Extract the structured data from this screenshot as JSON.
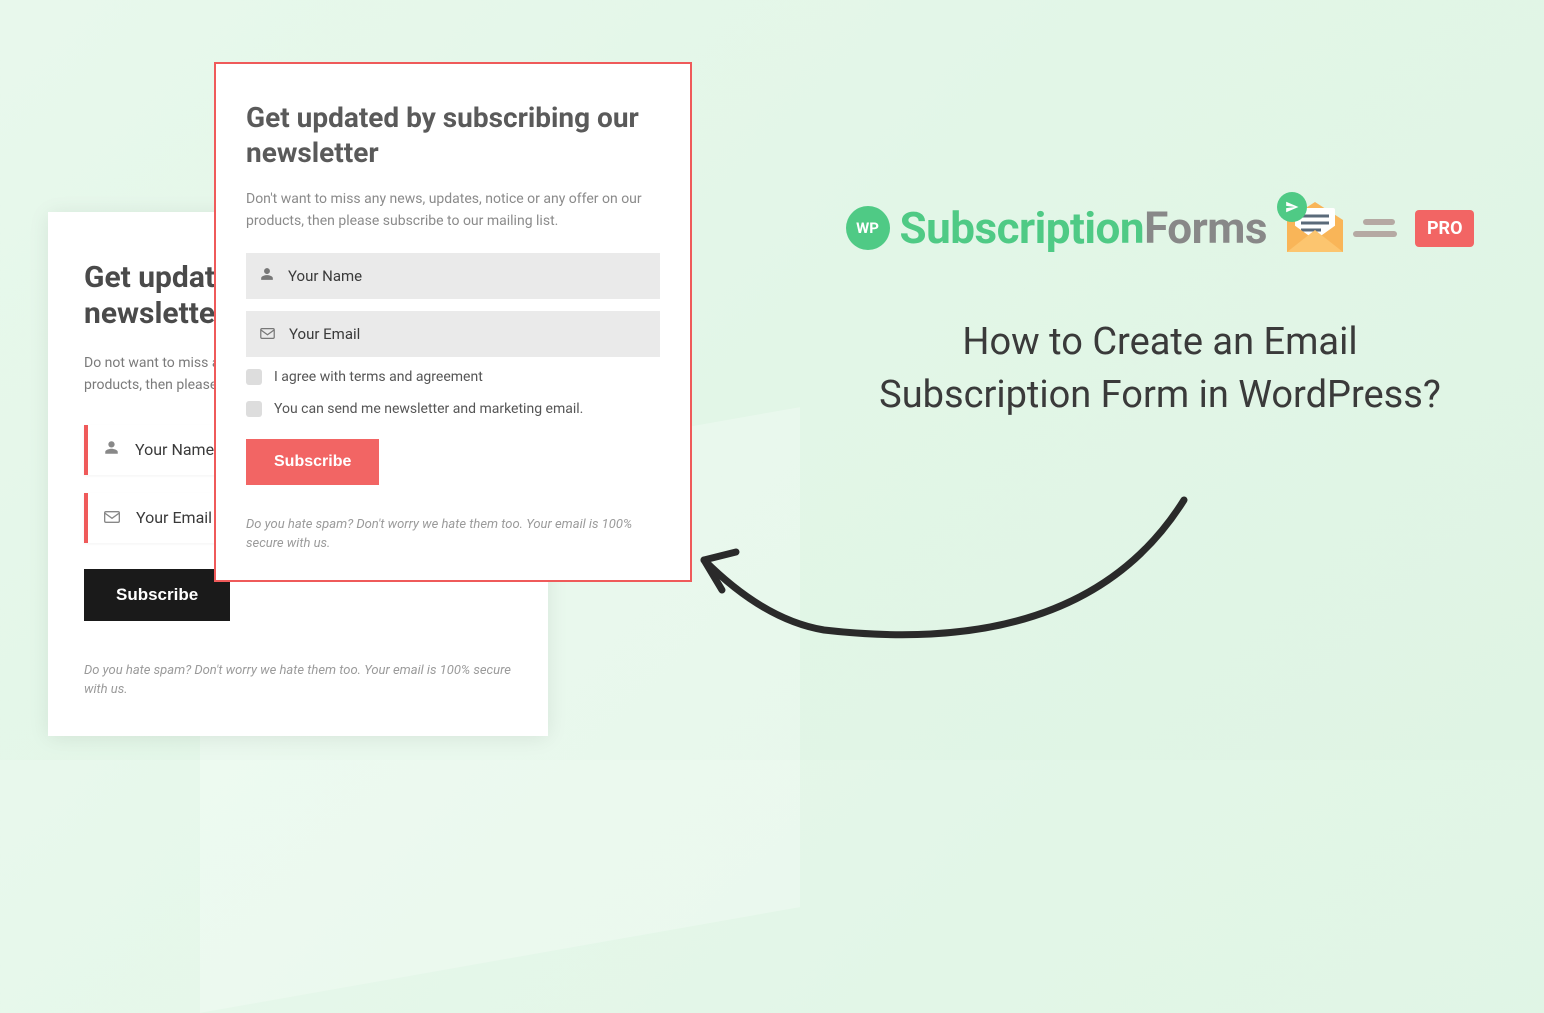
{
  "brand": {
    "wp_badge": "WP",
    "word_subscription": "Subscription",
    "word_forms": "Forms",
    "pro_label": "PRO"
  },
  "page_title": "How to Create an Email Subscription Form in WordPress?",
  "form_back": {
    "heading": "Get updated by subscribing our newsletter",
    "description": "Do not want to miss any news, updates, notice or any offer on our products, then please subscribe to our mailing list.",
    "name_placeholder": "Your Name",
    "email_placeholder": "Your Email Address",
    "button_label": "Subscribe",
    "footnote": "Do you hate spam? Don't worry we hate them too. Your email is 100% secure with us."
  },
  "form_front": {
    "heading": "Get updated by subscribing our newsletter",
    "description": "Don't want to miss any news, updates, notice or any offer on our products, then please subscribe to our mailing list.",
    "name_placeholder": "Your Name",
    "email_placeholder": "Your Email",
    "checkbox_terms": "I agree with terms and agreement",
    "checkbox_marketing": "You can send me newsletter and marketing email.",
    "button_label": "Subscribe",
    "footnote": "Do you hate spam? Don't worry we hate them too. Your email is 100% secure with us."
  }
}
